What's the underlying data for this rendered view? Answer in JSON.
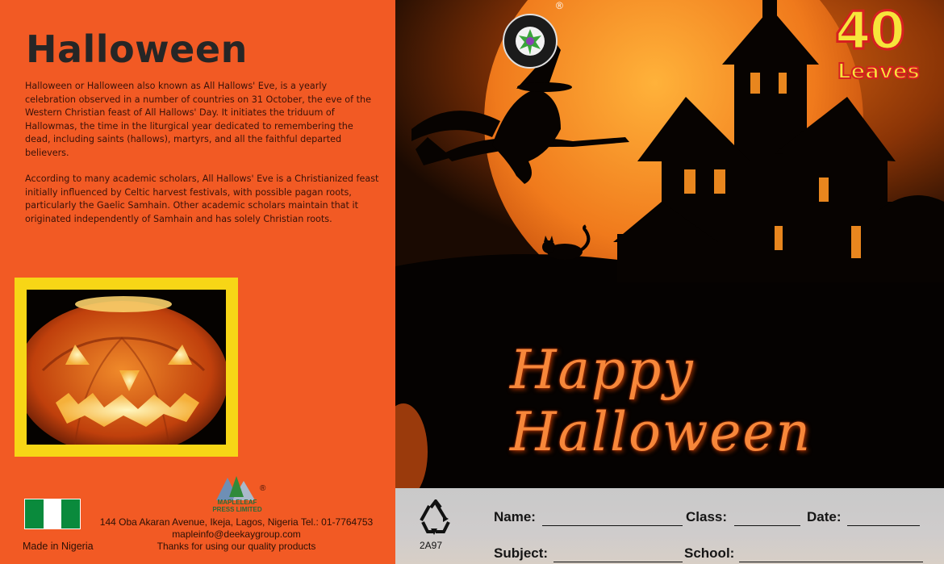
{
  "left": {
    "title": "Halloween",
    "paragraph1": "Halloween or Halloween  also known as All Hallows' Eve, is a yearly celebration observed in a number of countries on 31 October, the eve of the Western Christian feast of All Hallows' Day. It initiates the triduum of Hallowmas, the time in the liturgical year dedicated to remembering the dead, including saints (hallows), martyrs, and all the faithful departed believers.",
    "paragraph2": "According to many academic scholars, All Hallows' Eve is a Christianized feast initially influenced by Celtic harvest festivals, with possible pagan roots, particularly the Gaelic Samhain. Other academic scholars maintain that it originated independently of Samhain and has solely Christian roots.",
    "made_in": "Made in Nigeria",
    "logo_line1": "MAPLELEAF",
    "logo_line2": "PRESS LIMITED",
    "registered": "®",
    "address": "144 Oba Akaran Avenue, Ikeja, Lagos, Nigeria Tel.: 01-7764753",
    "email": "mapleinfo@deekaygroup.com",
    "thanks": "Thanks for using our quality products",
    "flag_colors": [
      "#0a8a3c",
      "#ffffff",
      "#0a8a3c"
    ]
  },
  "cover": {
    "seal_text": "MAPLE LEAF PRESS LIMITED",
    "registered": "®",
    "badge_number": "40",
    "badge_word": "Leaves",
    "greeting": "Happy Halloween",
    "accent": "#f7873a",
    "moon": "#f07a1c"
  },
  "form": {
    "code": "2A97",
    "name_label": "Name:",
    "class_label": "Class:",
    "date_label": "Date:",
    "subject_label": "Subject:",
    "school_label": "School:"
  }
}
